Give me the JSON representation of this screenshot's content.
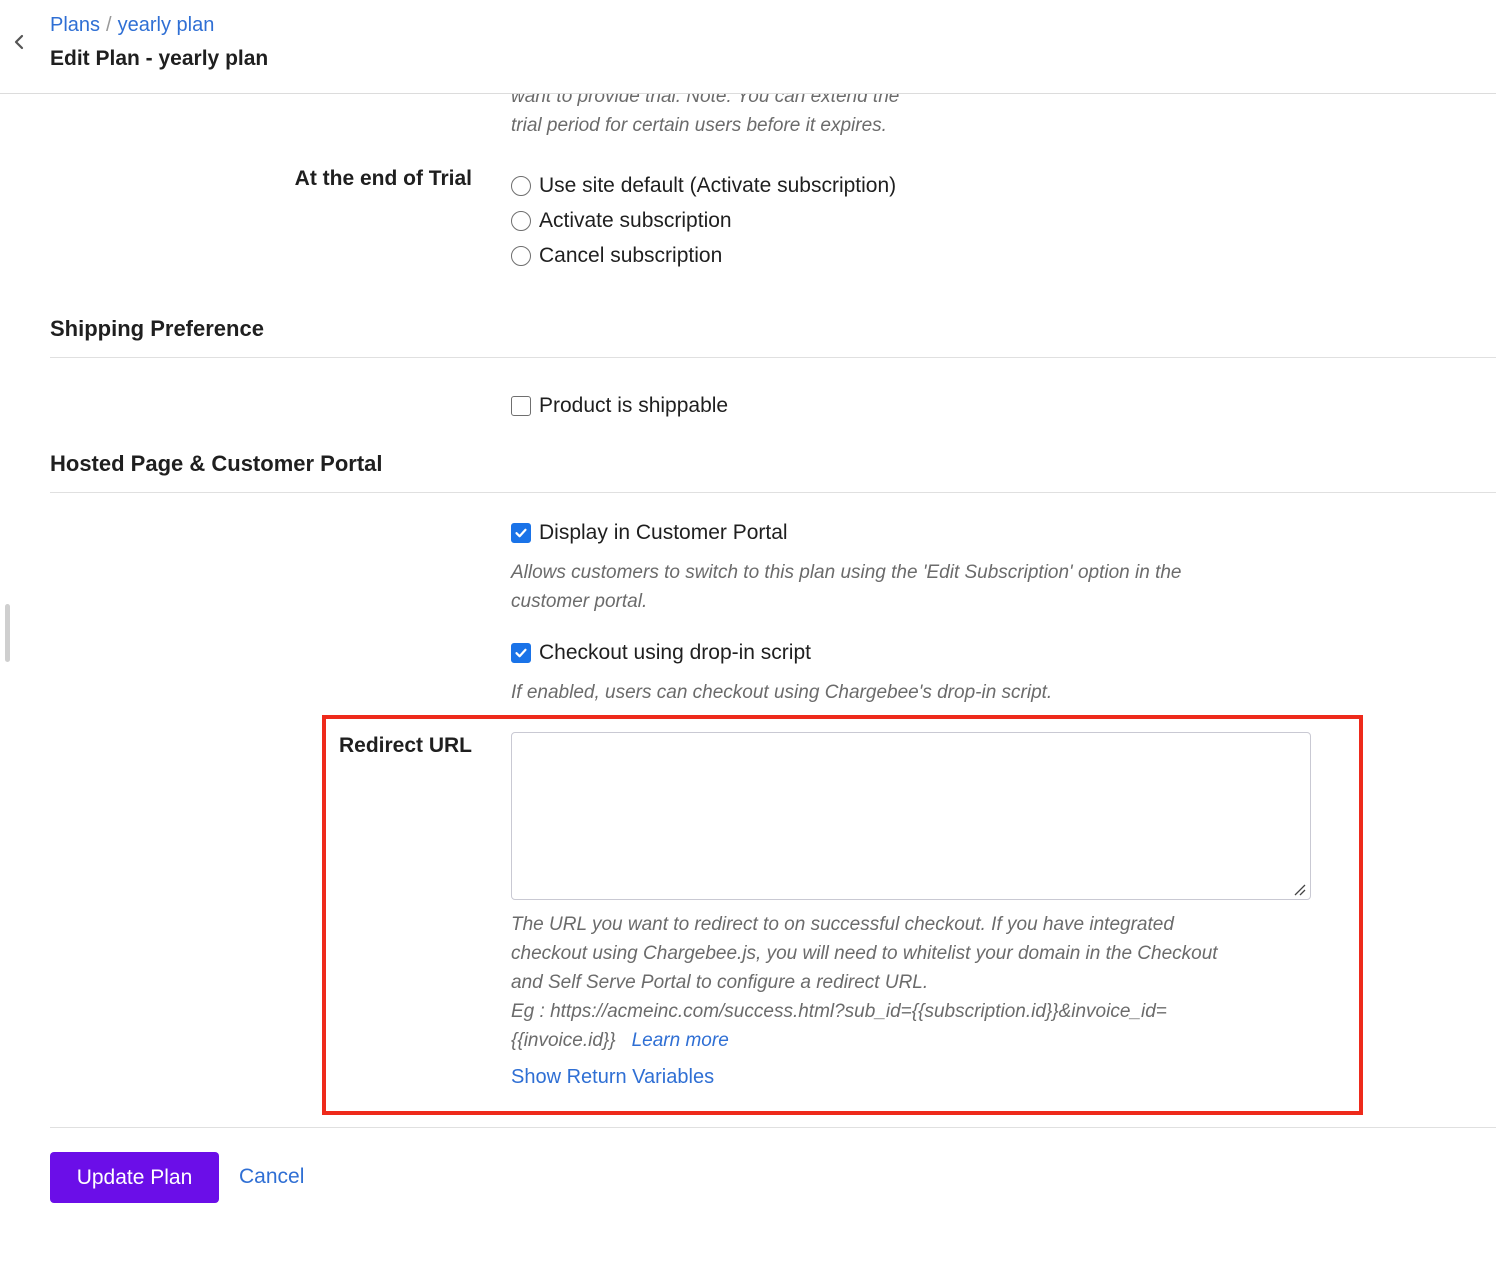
{
  "breadcrumb": {
    "parent": "Plans",
    "separator": "/",
    "current": "yearly plan"
  },
  "page_title": "Edit Plan - yearly plan",
  "trial": {
    "help_line1": "want to provide trial. Note: You can extend the",
    "help_line2": "trial period for certain users before it expires.",
    "end_label": "At the end of Trial",
    "options": [
      "Use site default (Activate subscription)",
      "Activate subscription",
      "Cancel subscription"
    ]
  },
  "shipping": {
    "section_title": "Shipping Preference",
    "shippable_label": "Product is shippable",
    "shippable_checked": false
  },
  "hosted": {
    "section_title": "Hosted Page & Customer Portal",
    "display_label": "Display in Customer Portal",
    "display_checked": true,
    "display_help_line1": "Allows customers to switch to this plan using the 'Edit Subscription' option in the",
    "display_help_line2": "customer portal.",
    "dropin_label": "Checkout using drop-in script",
    "dropin_checked": true,
    "dropin_help": "If enabled, users can checkout using Chargebee's drop-in script."
  },
  "redirect": {
    "label": "Redirect URL",
    "value": "",
    "help_line1": "The URL you want to redirect to on successful checkout. If you have integrated",
    "help_line2": "checkout using Chargebee.js, you will need to whitelist your domain in the Checkout",
    "help_line3": "and Self Serve Portal to configure a redirect URL.",
    "example_line1": "Eg : https://acmeinc.com/success.html?sub_id={{subscription.id}}&invoice_id=",
    "example_line2": "{{invoice.id}}",
    "learn_more": "Learn more",
    "show_return_variables": "Show Return Variables"
  },
  "actions": {
    "update_label": "Update Plan",
    "cancel_label": "Cancel"
  },
  "colors": {
    "accent": "#6b0ee8",
    "link": "#2f6fd4",
    "checkbox": "#1a73e8",
    "highlight": "#ee2a1b"
  }
}
